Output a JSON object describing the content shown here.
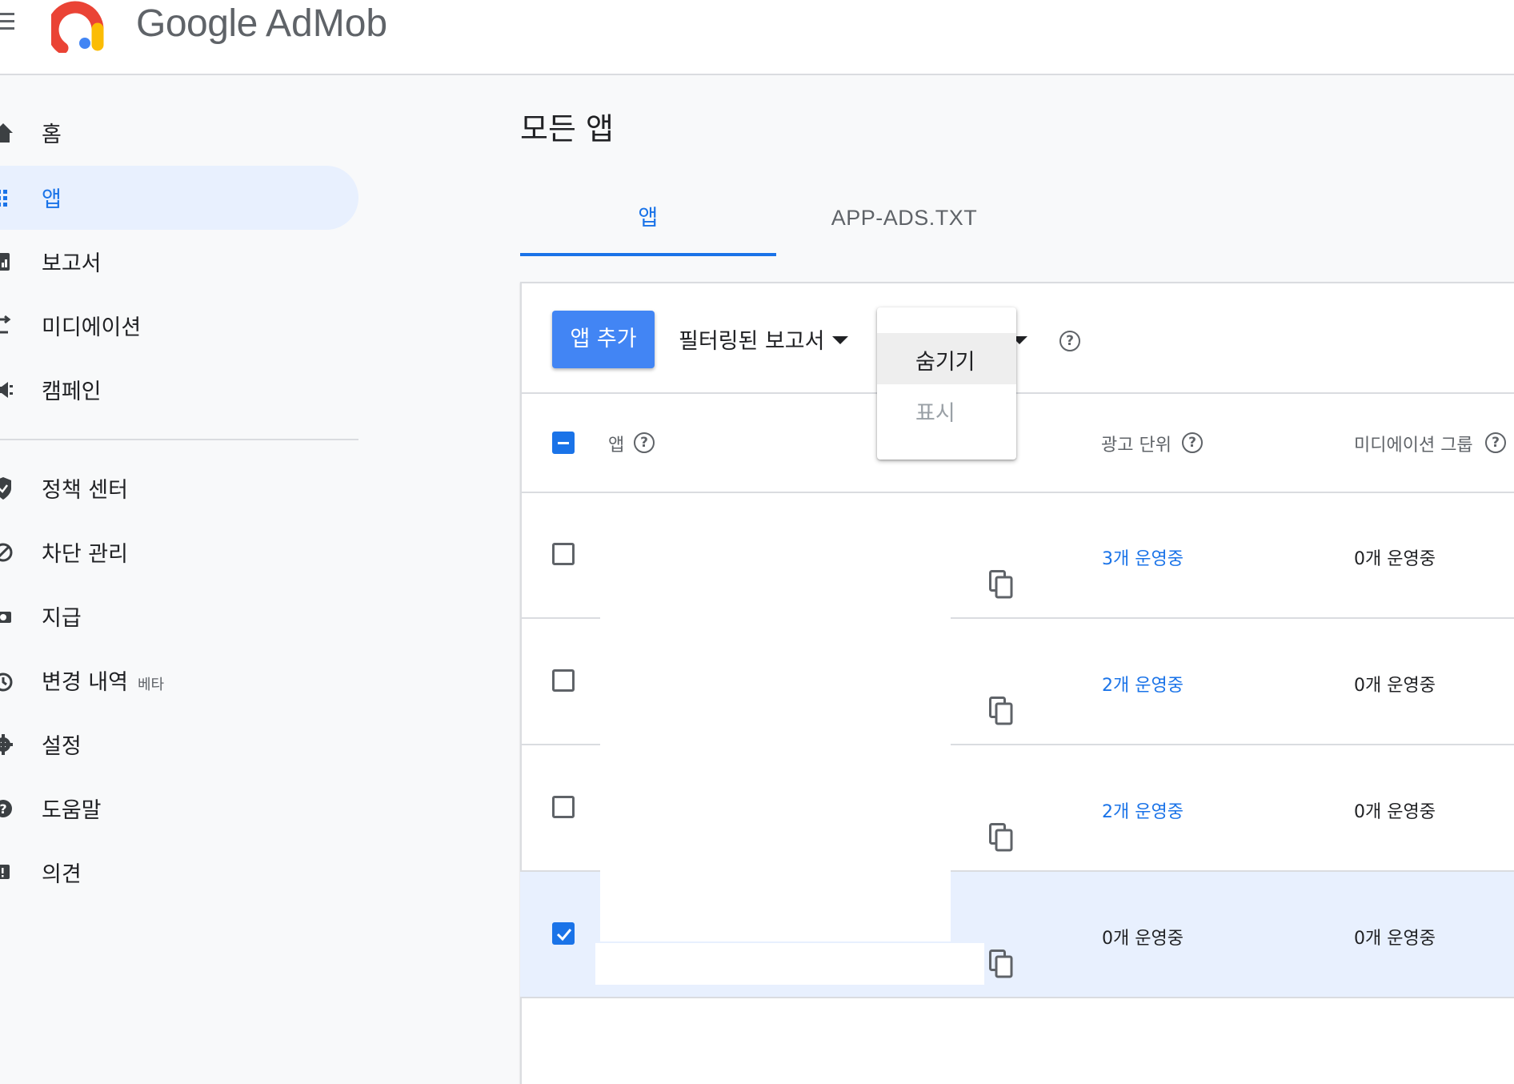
{
  "app": {
    "logo_google": "Google",
    "logo_admob": "AdMob"
  },
  "sidebar": {
    "items": [
      {
        "label": "홈",
        "icon": "home-icon"
      },
      {
        "label": "앱",
        "icon": "apps-grid-icon",
        "active": true
      },
      {
        "label": "보고서",
        "icon": "report-icon"
      },
      {
        "label": "미디에이션",
        "icon": "mediation-icon"
      },
      {
        "label": "캠페인",
        "icon": "campaign-icon"
      },
      {
        "label": "정책 센터",
        "icon": "policy-shield-icon"
      },
      {
        "label": "차단 관리",
        "icon": "block-icon"
      },
      {
        "label": "지급",
        "icon": "payments-icon"
      },
      {
        "label": "변경 내역",
        "icon": "history-icon",
        "badge": "베타"
      },
      {
        "label": "설정",
        "icon": "settings-gear-icon"
      },
      {
        "label": "도움말",
        "icon": "help-icon"
      },
      {
        "label": "의견",
        "icon": "feedback-icon"
      }
    ]
  },
  "main": {
    "title": "모든 앱",
    "tabs": [
      {
        "label": "앱",
        "active": true
      },
      {
        "label": "APP-ADS.TXT",
        "active": false
      }
    ],
    "toolbar": {
      "add_button": "앱 추가",
      "filter_label": "필터링된 보고서"
    },
    "dropdown": {
      "items": [
        "숨기기",
        "표시"
      ],
      "highlighted": "숨기기"
    },
    "table": {
      "headers": {
        "app": "앱",
        "ad_units": "광고 단위",
        "mediation_groups": "미디에이션 그룹"
      },
      "header_checkbox": "indeterminate",
      "rows": [
        {
          "checked": false,
          "ad_units": "3개 운영중",
          "ad_units_link": true,
          "mediation": "0개 운영중"
        },
        {
          "checked": false,
          "ad_units": "2개 운영중",
          "ad_units_link": true,
          "mediation": "0개 운영중"
        },
        {
          "checked": false,
          "ad_units": "2개 운영중",
          "ad_units_link": true,
          "mediation": "0개 운영중"
        },
        {
          "checked": true,
          "ad_units": "0개 운영중",
          "ad_units_link": false,
          "mediation": "0개 운영중"
        }
      ]
    }
  },
  "colors": {
    "accent": "#1a73e8",
    "primary_button": "#4285f4",
    "selected_row": "#e8f0fe"
  }
}
